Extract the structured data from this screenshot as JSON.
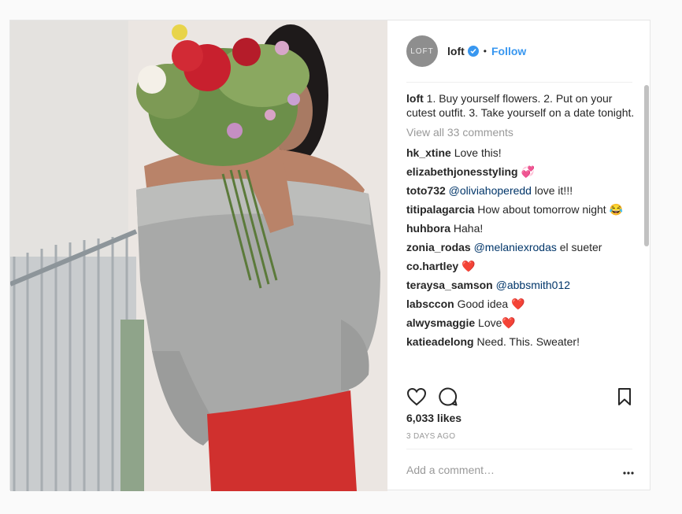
{
  "post": {
    "avatar_text": "LOFT",
    "username": "loft",
    "separator": "•",
    "follow_label": "Follow",
    "caption_user": "loft",
    "caption_text": " 1. Buy yourself flowers. 2. Put on your cutest outfit. 3. Take yourself on a date tonight.",
    "view_all": "View all 33 comments",
    "comments": [
      {
        "user": "hk_xtine",
        "text": " Love this!"
      },
      {
        "user": "elizabethjonesstyling",
        "text": " 💞"
      },
      {
        "user": "toto732",
        "mention": " @oliviahoperedd",
        "text": " love it!!!"
      },
      {
        "user": "titipalagarcia",
        "text": " How about tomorrow night 😂"
      },
      {
        "user": "huhbora",
        "text": " Haha!"
      },
      {
        "user": "zonia_rodas",
        "mention": " @melaniexrodas",
        "text": " el sueter"
      },
      {
        "user": "co.hartley",
        "text": " ❤️"
      },
      {
        "user": "teraysa_samson",
        "mention": " @abbsmith012",
        "text": ""
      },
      {
        "user": "labsccon",
        "text": " Good idea ❤️"
      },
      {
        "user": "alwysmaggie",
        "text": " Love❤️"
      },
      {
        "user": "katieadelong",
        "text": " Need. This. Sweater!"
      }
    ],
    "likes": "6,033 likes",
    "time": "3 DAYS AGO",
    "add_comment_placeholder": "Add a comment…",
    "icons": [
      "heart-icon",
      "comment-icon",
      "bookmark-icon",
      "more-icon",
      "verified-badge-icon"
    ],
    "colors": {
      "link": "#3897f0",
      "mention": "#003569",
      "muted": "#999999"
    }
  }
}
